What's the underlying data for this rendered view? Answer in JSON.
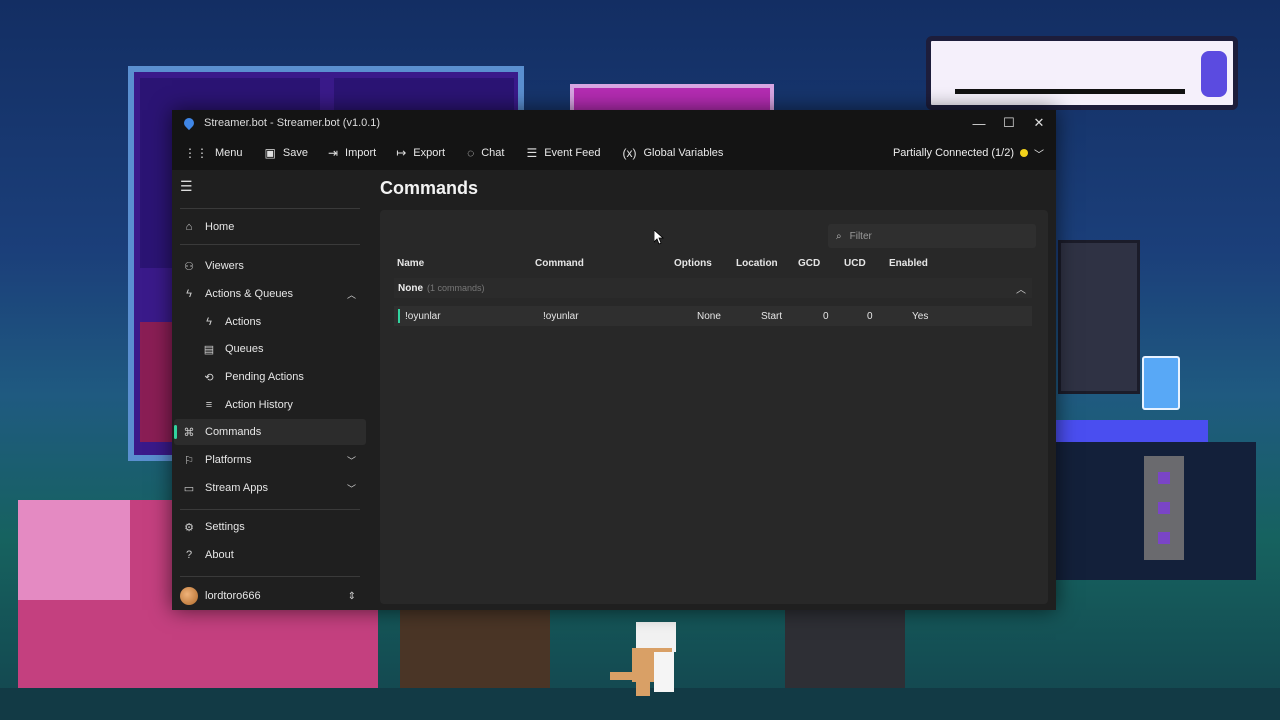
{
  "window": {
    "title": "Streamer.bot - Streamer.bot (v1.0.1)",
    "controls": {
      "minimize": "—",
      "maximize": "☐",
      "close": "✕"
    }
  },
  "toolbar": {
    "items": [
      {
        "icon": "menu-grid-icon",
        "glyph": "⋮⋮",
        "label": "Menu"
      },
      {
        "icon": "save-icon",
        "glyph": "▣",
        "label": "Save"
      },
      {
        "icon": "import-icon",
        "glyph": "⇥",
        "label": "Import"
      },
      {
        "icon": "export-icon",
        "glyph": "↦",
        "label": "Export"
      },
      {
        "icon": "chat-icon",
        "glyph": "◌",
        "label": "Chat"
      },
      {
        "icon": "event-feed-icon",
        "glyph": "☰",
        "label": "Event Feed"
      },
      {
        "icon": "global-variables-icon",
        "glyph": "(x)",
        "label": "Global Variables"
      }
    ],
    "connection": {
      "label": "Partially Connected (1/2)",
      "status_color": "#f2d21b"
    }
  },
  "sidebar": {
    "items": [
      {
        "id": "home",
        "icon": "home-icon",
        "glyph": "⌂",
        "label": "Home"
      },
      {
        "id": "viewers",
        "icon": "person-icon",
        "glyph": "⚇",
        "label": "Viewers"
      },
      {
        "id": "actions-queues",
        "icon": "bolt-icon",
        "glyph": "ϟ",
        "label": "Actions & Queues",
        "chevron": "︿"
      },
      {
        "id": "actions",
        "icon": "bolt-icon",
        "glyph": "ϟ",
        "label": "Actions"
      },
      {
        "id": "queues",
        "icon": "queue-icon",
        "glyph": "▤",
        "label": "Queues"
      },
      {
        "id": "pending-actions",
        "icon": "pending-icon",
        "glyph": "⟲",
        "label": "Pending Actions"
      },
      {
        "id": "action-history",
        "icon": "history-icon",
        "glyph": "≡",
        "label": "Action History"
      },
      {
        "id": "commands",
        "icon": "command-icon",
        "glyph": "⌘",
        "label": "Commands",
        "active": true
      },
      {
        "id": "platforms",
        "icon": "platforms-icon",
        "glyph": "⚐",
        "label": "Platforms",
        "chevron": "﹀"
      },
      {
        "id": "stream-apps",
        "icon": "stream-apps-icon",
        "glyph": "▭",
        "label": "Stream Apps",
        "chevron": "﹀"
      },
      {
        "id": "settings",
        "icon": "gear-icon",
        "glyph": "⚙",
        "label": "Settings"
      },
      {
        "id": "about",
        "icon": "question-icon",
        "glyph": "?",
        "label": "About"
      }
    ],
    "user": {
      "name": "lordtoro666",
      "chevron": "⇕"
    }
  },
  "main": {
    "title": "Commands",
    "filter": {
      "placeholder": "Filter",
      "value": ""
    },
    "columns": [
      "Name",
      "Command",
      "Options",
      "Location",
      "GCD",
      "UCD",
      "Enabled"
    ],
    "group": {
      "name": "None",
      "count": "(1 commands)"
    },
    "rows": [
      {
        "name": "!oyunlar",
        "command": "!oyunlar",
        "options": "None",
        "location": "Start",
        "gcd": "0",
        "ucd": "0",
        "enabled": "Yes"
      }
    ]
  }
}
